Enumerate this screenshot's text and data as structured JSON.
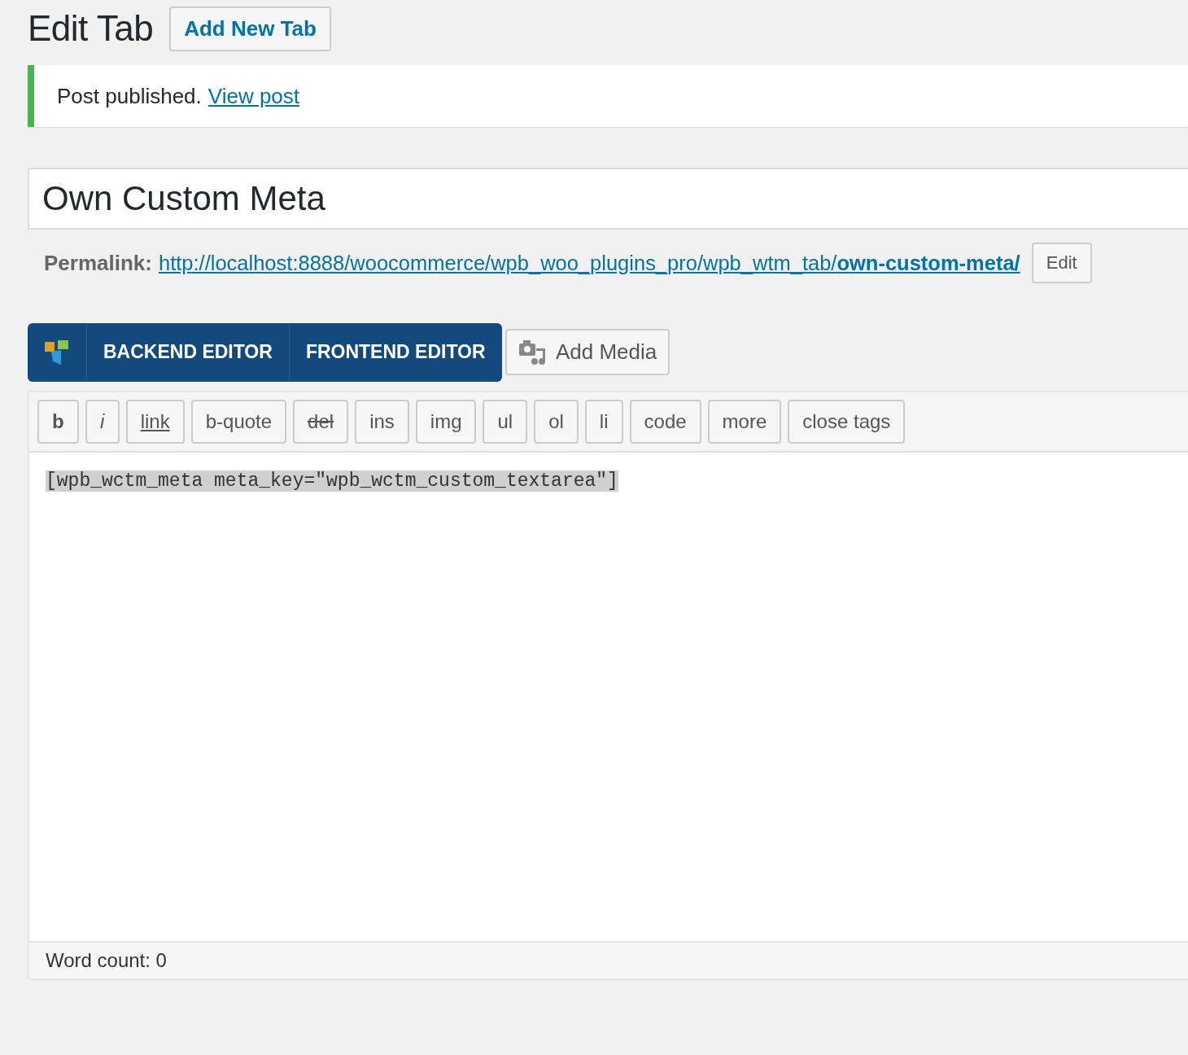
{
  "heading": {
    "title": "Edit Tab",
    "add_button": "Add New Tab"
  },
  "notice": {
    "message": "Post published.",
    "link": "View post"
  },
  "post_title": {
    "value": "Own Custom Meta"
  },
  "permalink": {
    "label": "Permalink:",
    "url": "http://localhost:8888/woocommerce/wpb_woo_plugins_pro/wpb_wtm_tab/**own-custom-meta/**",
    "edit_button": "Edit"
  },
  "builder_bar": {
    "buttons": [
      "BACKEND EDITOR",
      "FRONTEND EDITOR"
    ]
  },
  "add_media": "Add Media",
  "quicktags": [
    {
      "label": "b",
      "kind": "bold"
    },
    {
      "label": "i",
      "kind": "italic"
    },
    {
      "label": "link",
      "kind": "underline"
    },
    {
      "label": "b-quote",
      "kind": "plain"
    },
    {
      "label": "del",
      "kind": "strike"
    },
    {
      "label": "ins",
      "kind": "plain"
    },
    {
      "label": "img",
      "kind": "plain"
    },
    {
      "label": "ul",
      "kind": "plain"
    },
    {
      "label": "ol",
      "kind": "plain"
    },
    {
      "label": "li",
      "kind": "plain"
    },
    {
      "label": "code",
      "kind": "plain"
    },
    {
      "label": "more",
      "kind": "plain"
    },
    {
      "label": "close tags",
      "kind": "plain"
    }
  ],
  "editor": {
    "content": "[wpb_wctm_meta meta_key=\"wpb_wctm_custom_textarea\"]",
    "selected": true
  },
  "word_count": "Word count: 0"
}
